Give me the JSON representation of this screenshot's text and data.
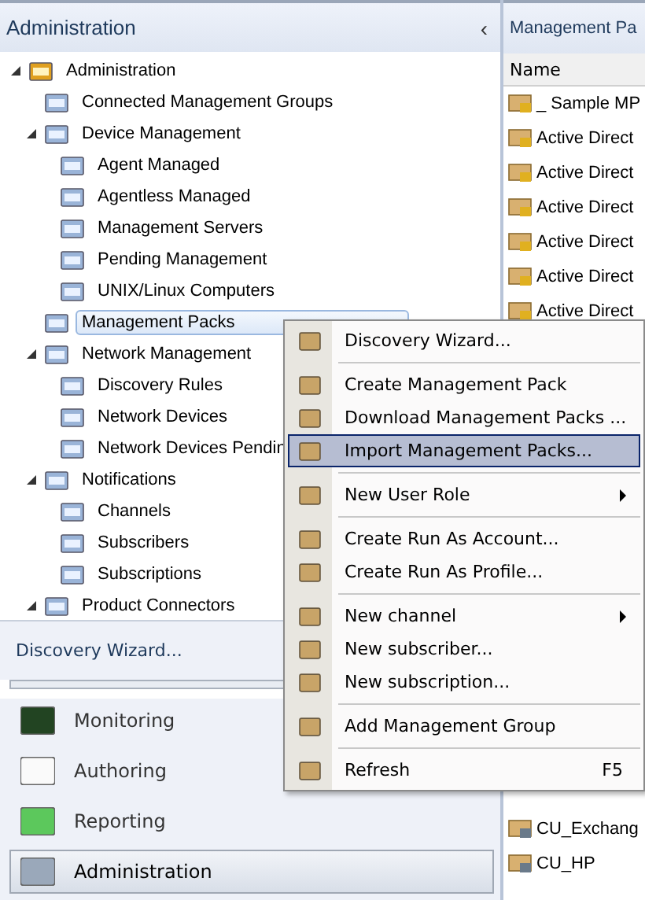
{
  "left_panel": {
    "title": "Administration",
    "collapse_glyph": "‹",
    "tree": [
      {
        "label": "Administration",
        "expanded": true,
        "selected": false,
        "children": [
          {
            "label": "Connected Management Groups",
            "selected": false
          },
          {
            "label": "Device Management",
            "expanded": true,
            "selected": false,
            "children": [
              {
                "label": "Agent Managed",
                "selected": false
              },
              {
                "label": "Agentless Managed",
                "selected": false
              },
              {
                "label": "Management Servers",
                "selected": false
              },
              {
                "label": "Pending Management",
                "selected": false
              },
              {
                "label": "UNIX/Linux Computers",
                "selected": false
              }
            ]
          },
          {
            "label": "Management Packs",
            "selected": true
          },
          {
            "label": "Network Management",
            "expanded": true,
            "selected": false,
            "children": [
              {
                "label": "Discovery Rules",
                "selected": false
              },
              {
                "label": "Network Devices",
                "selected": false
              },
              {
                "label": "Network Devices Pendin",
                "selected": false
              }
            ]
          },
          {
            "label": "Notifications",
            "expanded": true,
            "selected": false,
            "children": [
              {
                "label": "Channels",
                "selected": false
              },
              {
                "label": "Subscribers",
                "selected": false
              },
              {
                "label": "Subscriptions",
                "selected": false
              }
            ]
          },
          {
            "label": "Product Connectors",
            "expanded": true,
            "selected": false
          }
        ]
      }
    ],
    "task_link": "Discovery Wizard...",
    "workspaces": [
      {
        "label": "Monitoring",
        "selected": false
      },
      {
        "label": "Authoring",
        "selected": false
      },
      {
        "label": "Reporting",
        "selected": false
      },
      {
        "label": "Administration",
        "selected": true
      }
    ]
  },
  "right_panel": {
    "title": "Management Pa",
    "column": "Name",
    "rows_top": [
      "_ Sample MP",
      "Active Direct",
      "Active Direct",
      "Active Direct",
      "Active Direct",
      "Active Direct",
      "Active Direct"
    ],
    "rows_bottom": [
      "CU_Exchang",
      "CU_HP"
    ]
  },
  "context_menu": [
    {
      "kind": "item",
      "label": "Discovery Wizard...",
      "selected": false
    },
    {
      "kind": "separator"
    },
    {
      "kind": "item",
      "label": "Create Management Pack",
      "selected": false
    },
    {
      "kind": "item",
      "label": "Download Management Packs ...",
      "selected": false
    },
    {
      "kind": "item",
      "label": "Import Management Packs...",
      "selected": true
    },
    {
      "kind": "separator"
    },
    {
      "kind": "item",
      "label": "New User Role",
      "submenu": true,
      "selected": false
    },
    {
      "kind": "separator"
    },
    {
      "kind": "item",
      "label": "Create Run As Account...",
      "selected": false
    },
    {
      "kind": "item",
      "label": "Create Run As Profile...",
      "selected": false
    },
    {
      "kind": "separator"
    },
    {
      "kind": "item",
      "label": "New channel",
      "submenu": true,
      "selected": false
    },
    {
      "kind": "item",
      "label": "New subscriber...",
      "selected": false
    },
    {
      "kind": "item",
      "label": "New subscription...",
      "selected": false
    },
    {
      "kind": "separator"
    },
    {
      "kind": "item",
      "label": "Add Management Group",
      "selected": false
    },
    {
      "kind": "separator"
    },
    {
      "kind": "item",
      "label": "Refresh",
      "shortcut": "F5",
      "selected": false
    }
  ]
}
